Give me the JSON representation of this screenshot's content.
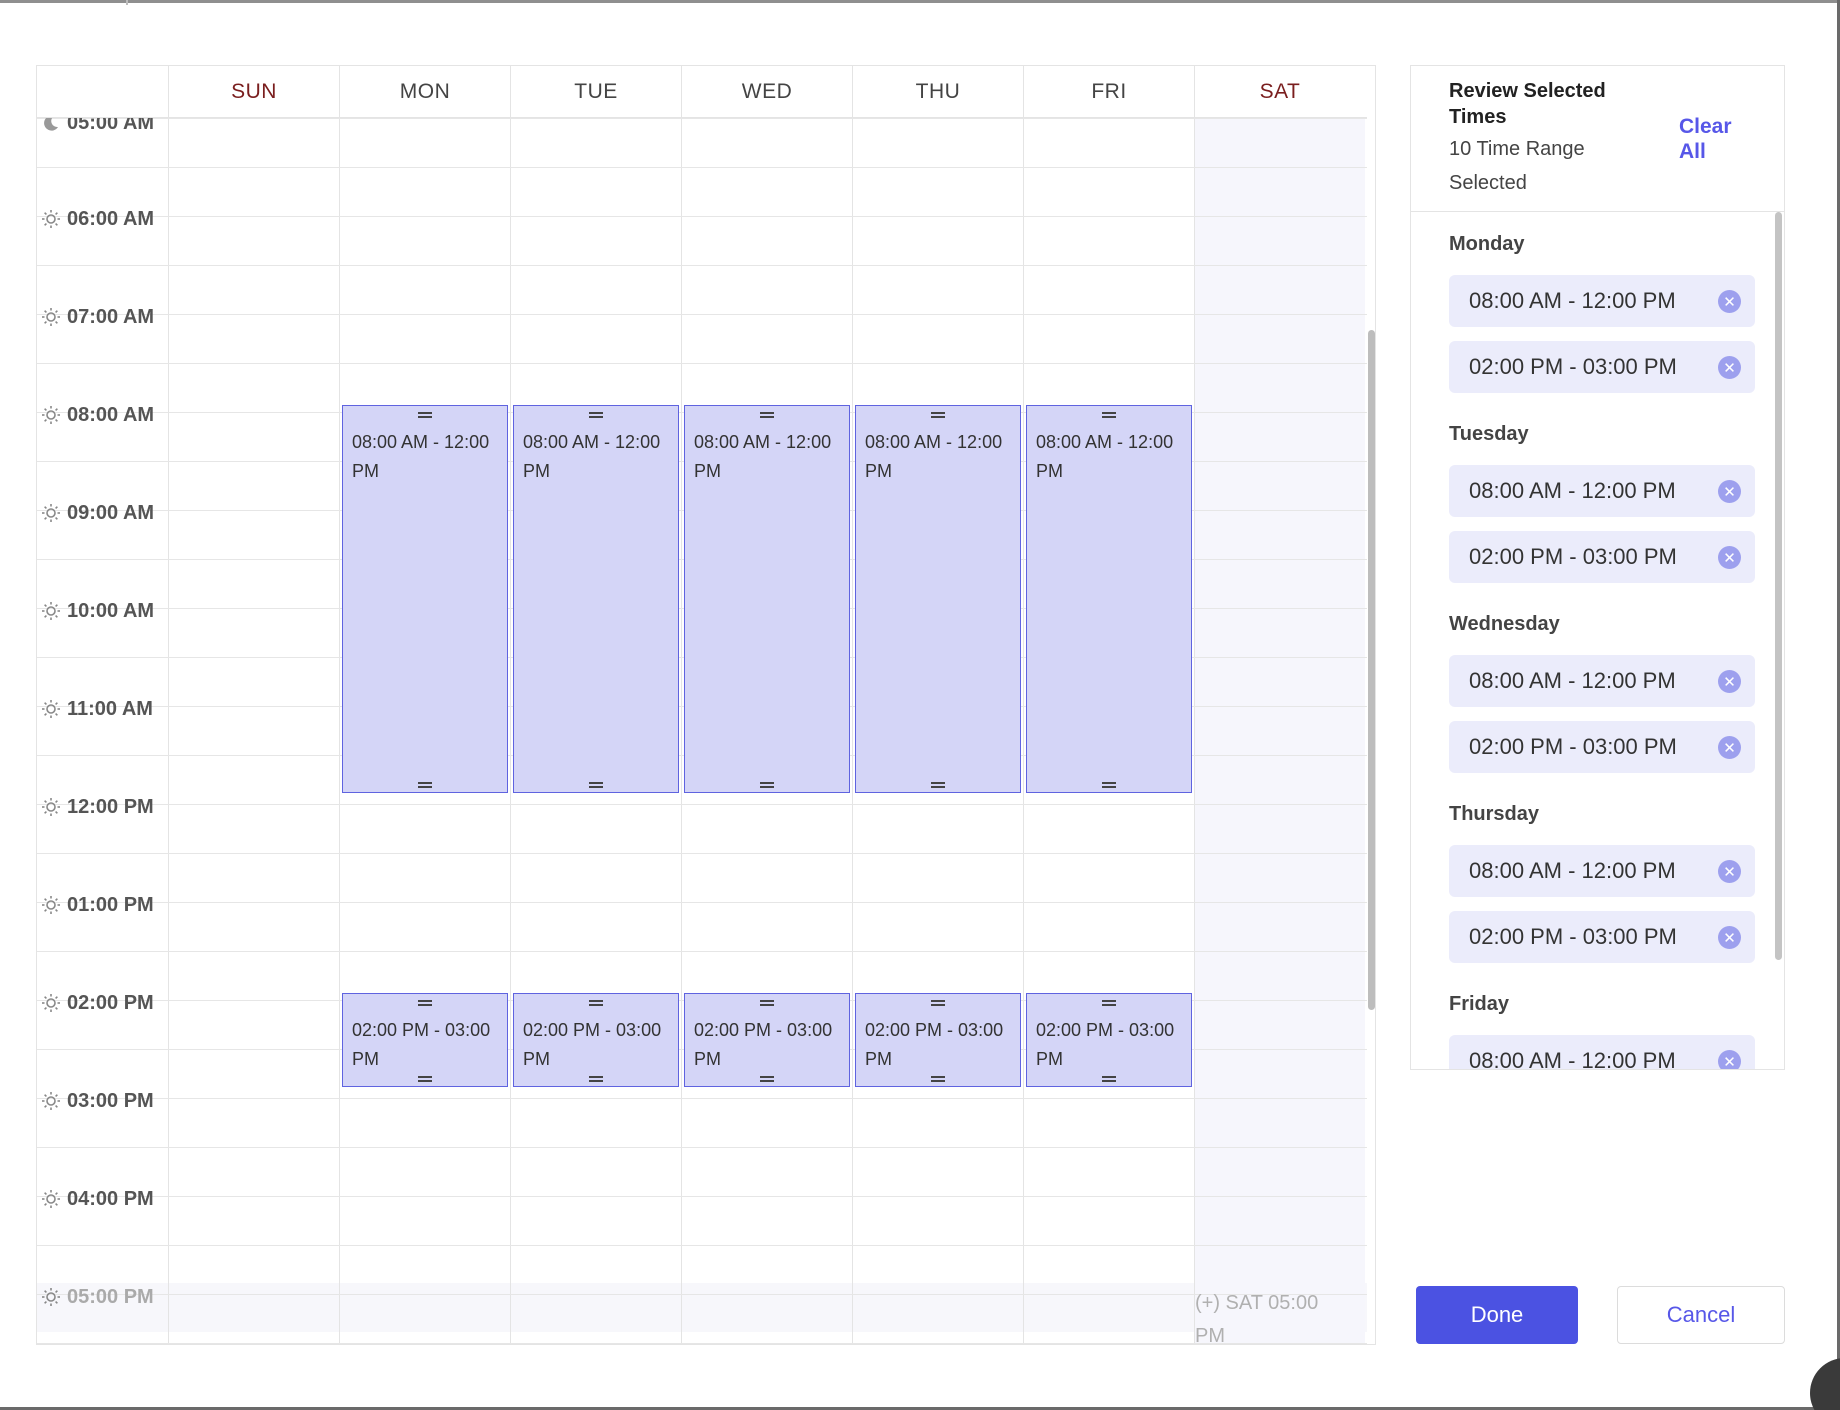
{
  "calendar": {
    "days": [
      {
        "label": "SUN",
        "weekend": true
      },
      {
        "label": "MON",
        "weekend": false
      },
      {
        "label": "TUE",
        "weekend": false
      },
      {
        "label": "WED",
        "weekend": false
      },
      {
        "label": "THU",
        "weekend": false
      },
      {
        "label": "FRI",
        "weekend": false
      },
      {
        "label": "SAT",
        "weekend": true
      }
    ],
    "times": [
      {
        "label": "05:00 AM",
        "icon": "moon-icon"
      },
      {
        "label": "06:00 AM",
        "icon": "sun-icon"
      },
      {
        "label": "07:00 AM",
        "icon": "sun-icon"
      },
      {
        "label": "08:00 AM",
        "icon": "sun-icon"
      },
      {
        "label": "09:00 AM",
        "icon": "sun-icon"
      },
      {
        "label": "10:00 AM",
        "icon": "sun-icon"
      },
      {
        "label": "11:00 AM",
        "icon": "sun-icon"
      },
      {
        "label": "12:00 PM",
        "icon": "sun-icon"
      },
      {
        "label": "01:00 PM",
        "icon": "sun-icon"
      },
      {
        "label": "02:00 PM",
        "icon": "sun-icon"
      },
      {
        "label": "03:00 PM",
        "icon": "sun-icon"
      },
      {
        "label": "04:00 PM",
        "icon": "sun-icon"
      },
      {
        "label": "05:00 PM",
        "icon": "sun-icon"
      }
    ],
    "blocks": [
      {
        "day": "MON",
        "label": "08:00 AM - 12:00 PM"
      },
      {
        "day": "TUE",
        "label": "08:00 AM - 12:00 PM"
      },
      {
        "day": "WED",
        "label": "08:00 AM - 12:00 PM"
      },
      {
        "day": "THU",
        "label": "08:00 AM - 12:00 PM"
      },
      {
        "day": "FRI",
        "label": "08:00 AM - 12:00 PM"
      },
      {
        "day": "MON",
        "label": "02:00 PM - 03:00 PM"
      },
      {
        "day": "TUE",
        "label": "02:00 PM - 03:00 PM"
      },
      {
        "day": "WED",
        "label": "02:00 PM - 03:00 PM"
      },
      {
        "day": "THU",
        "label": "02:00 PM - 03:00 PM"
      },
      {
        "day": "FRI",
        "label": "02:00 PM - 03:00 PM"
      }
    ],
    "add_slot_label": "(+) SAT 05:00 PM"
  },
  "review": {
    "title": "Review Selected Times",
    "count_text": "10 Time Range Selected",
    "clear_all": "Clear All",
    "groups": [
      {
        "day": "Monday",
        "ranges": [
          "08:00 AM - 12:00 PM",
          "02:00 PM - 03:00 PM"
        ]
      },
      {
        "day": "Tuesday",
        "ranges": [
          "08:00 AM - 12:00 PM",
          "02:00 PM - 03:00 PM"
        ]
      },
      {
        "day": "Wednesday",
        "ranges": [
          "08:00 AM - 12:00 PM",
          "02:00 PM - 03:00 PM"
        ]
      },
      {
        "day": "Thursday",
        "ranges": [
          "08:00 AM - 12:00 PM",
          "02:00 PM - 03:00 PM"
        ]
      },
      {
        "day": "Friday",
        "ranges": [
          "08:00 AM - 12:00 PM"
        ]
      }
    ]
  },
  "actions": {
    "done": "Done",
    "cancel": "Cancel"
  },
  "colors": {
    "accent": "#4b52e2",
    "selection_fill": "#d4d5f7",
    "selection_border": "#5f63e0",
    "weekend_text": "#7a1e1e"
  }
}
